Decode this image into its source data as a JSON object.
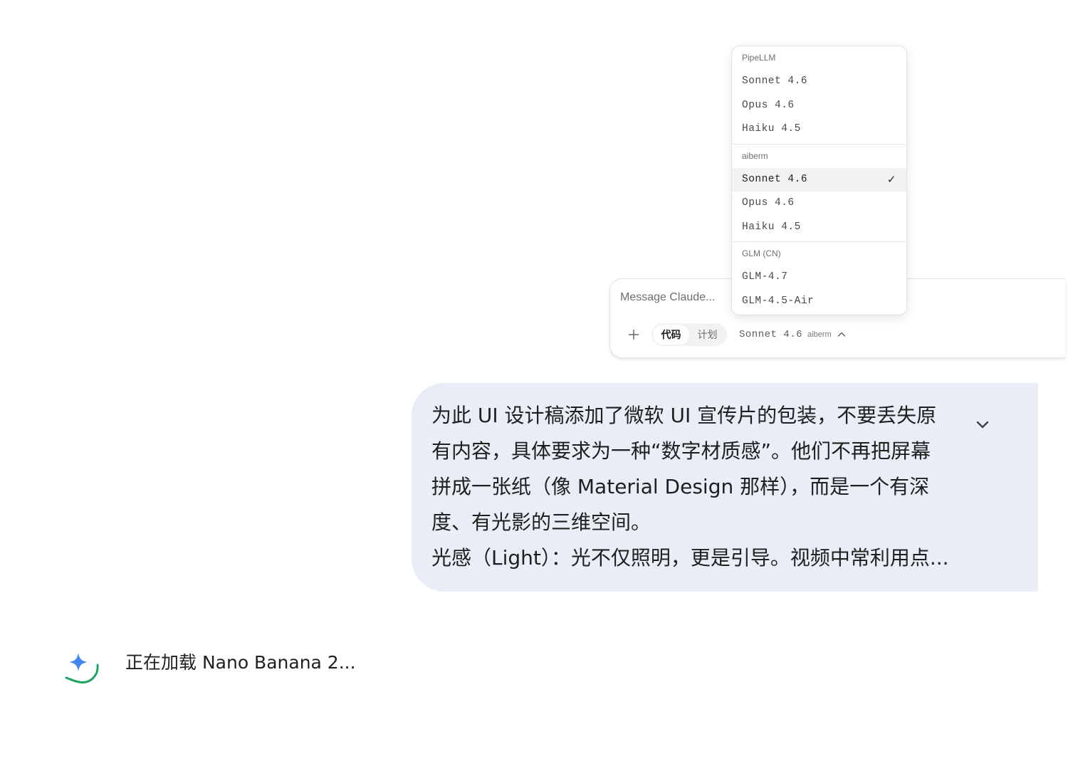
{
  "composer": {
    "placeholder": "Message Claude...",
    "modes": [
      {
        "label": "代码",
        "active": true
      },
      {
        "label": "计划",
        "active": false
      }
    ],
    "current_model": "Sonnet 4.6",
    "current_provider": "aiberm"
  },
  "model_menu": {
    "groups": [
      {
        "header": "PipeLLM",
        "items": [
          {
            "label": "Sonnet 4.6",
            "selected": false
          },
          {
            "label": "Opus 4.6",
            "selected": false
          },
          {
            "label": "Haiku 4.5",
            "selected": false
          }
        ]
      },
      {
        "header": "aiberm",
        "items": [
          {
            "label": "Sonnet 4.6",
            "selected": true
          },
          {
            "label": "Opus 4.6",
            "selected": false
          },
          {
            "label": "Haiku 4.5",
            "selected": false
          }
        ]
      },
      {
        "header": "GLM (CN)",
        "items": [
          {
            "label": "GLM-4.7",
            "selected": false
          },
          {
            "label": "GLM-4.5-Air",
            "selected": false
          }
        ]
      }
    ],
    "checkmark": "✓"
  },
  "prompt": {
    "text": "为此 UI 设计稿添加了微软 UI 宣传片的包装，不要丢失原\n有内容，具体要求为一种“数字材质感”。他们不再把屏幕\n拼成一张纸（像 Material Design 那样），而是一个有深\n度、有光影的三维空间。\n光感（Light）：光不仅照明，更是引导。视频中常利用点..."
  },
  "status": {
    "loading_text": "正在加载 Nano Banana 2..."
  },
  "colors": {
    "bubble_bg": "#e9eef6",
    "spark_blue": "#4285f4",
    "ring_green": "#1ea362",
    "selected_row": "#f2f2f2"
  }
}
